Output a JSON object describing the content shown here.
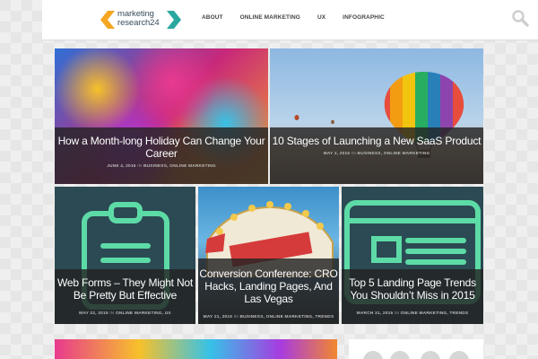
{
  "brand": {
    "logo_line1": "marketing",
    "logo_line2": "research24",
    "accent_orange": "#f5a623",
    "accent_teal": "#2aa8a0"
  },
  "nav": {
    "items": [
      {
        "label": "ABOUT"
      },
      {
        "label": "ONLINE MARKETING"
      },
      {
        "label": "UX"
      },
      {
        "label": "INFOGRAPHIC"
      }
    ]
  },
  "search": {
    "icon": "search-icon"
  },
  "posts": [
    {
      "title": "How a Month-long Holiday Can Change Your Career",
      "date": "JUNE 4, 2016",
      "in": "IN",
      "categories": "BUSINESS, ONLINE MARKETING"
    },
    {
      "title": "10 Stages of Launching a New SaaS Product",
      "date": "MAY 2, 2016",
      "in": "IN",
      "categories": "BUSINESS, ONLINE MARKETING"
    },
    {
      "title": "Web Forms – They Might Not Be Pretty But Effective",
      "date": "MAY 22, 2015",
      "in": "IN",
      "categories": "ONLINE MARKETING, UX",
      "icon": "clipboard-icon"
    },
    {
      "title": "Conversion Conference: CRO Hacks, Landing Pages, And Las Vegas",
      "date": "MAY 21, 2015",
      "in": "IN",
      "categories": "BUSINESS, ONLINE MARKETING, TRENDS"
    },
    {
      "title": "Top 5 Landing Page Trends You Shouldn’t Miss in 2015",
      "date": "MARCH 31, 2015",
      "in": "IN",
      "categories": "ONLINE MARKETING, TRENDS",
      "icon": "landing-page-icon"
    }
  ],
  "sidebar": {
    "social_icons": [
      "social-icon",
      "social-icon",
      "social-icon",
      "social-icon"
    ]
  }
}
